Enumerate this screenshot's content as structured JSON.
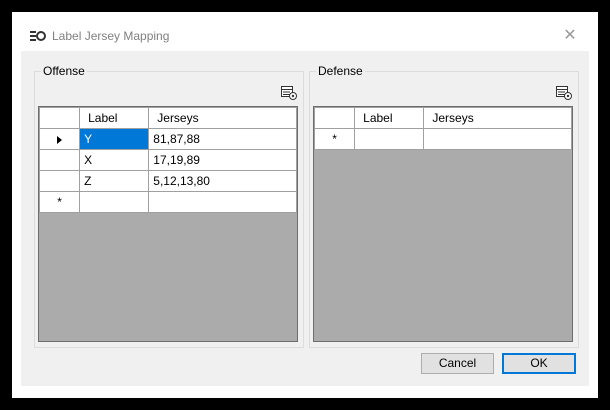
{
  "window": {
    "title": "Label Jersey Mapping",
    "close_glyph": "✕"
  },
  "offense": {
    "label": "Offense",
    "columns": [
      "Label",
      "Jerseys"
    ],
    "rows": [
      {
        "label": "Y",
        "jerseys": "81,87,88"
      },
      {
        "label": "X",
        "jerseys": "17,19,89"
      },
      {
        "label": "Z",
        "jerseys": "5,12,13,80"
      }
    ],
    "new_row_marker": "*"
  },
  "defense": {
    "label": "Defense",
    "columns": [
      "Label",
      "Jerseys"
    ],
    "rows": [],
    "new_row_marker": "*"
  },
  "buttons": {
    "cancel": "Cancel",
    "ok": "OK"
  },
  "colors": {
    "selection": "#0078d7",
    "grid_empty": "#ababab",
    "dialog_bg": "#f0f0f0"
  },
  "icons": {
    "app": "mapping-app-icon",
    "tool": "grid-settings-icon",
    "current_row": "row-pointer-icon"
  }
}
